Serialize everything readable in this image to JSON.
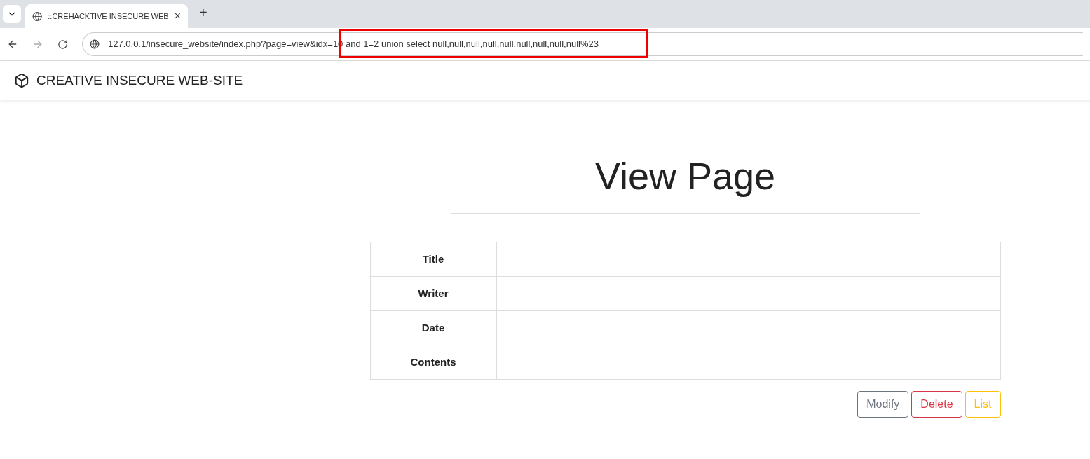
{
  "browser": {
    "tab": {
      "title": "::CREHACKTIVE INSECURE WEB",
      "close": "×"
    },
    "new_tab": "+",
    "url": "127.0.0.1/insecure_website/index.php?page=view&idx=10 and 1=2 union select null,null,null,null,null,null,null,null,null%23",
    "highlight": true
  },
  "navbar": {
    "brand": "CREATIVE INSECURE WEB-SITE"
  },
  "heading": "View Page",
  "table": {
    "rows": [
      {
        "label": "Title",
        "value": ""
      },
      {
        "label": "Writer",
        "value": ""
      },
      {
        "label": "Date",
        "value": ""
      },
      {
        "label": "Contents",
        "value": ""
      }
    ]
  },
  "buttons": [
    {
      "label": "Modify",
      "color": "#6c757d"
    },
    {
      "label": "Delete",
      "color": "#dc3545"
    },
    {
      "label": "List",
      "color": "#ffc107"
    }
  ]
}
